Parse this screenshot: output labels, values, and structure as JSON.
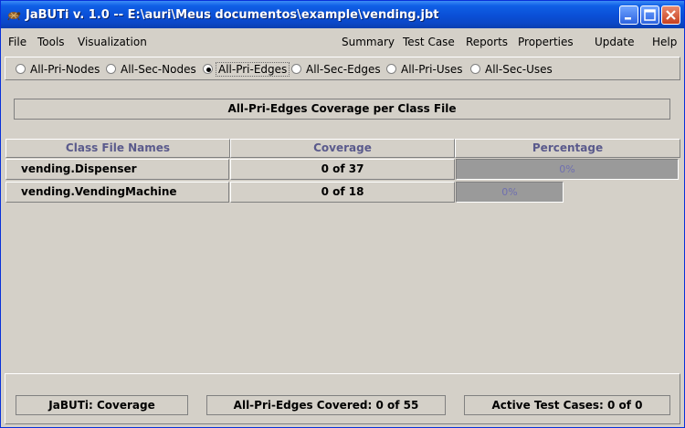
{
  "window": {
    "title": "JaBUTi v. 1.0 -- E:\\auri\\Meus documentos\\example\\vending.jbt"
  },
  "menu": {
    "left": [
      "File",
      "Tools",
      "Visualization"
    ],
    "right": [
      "Summary",
      "Test Case",
      "Reports",
      "Properties",
      "Update",
      "Help"
    ]
  },
  "criteria": {
    "options": [
      "All-Pri-Nodes",
      "All-Sec-Nodes",
      "All-Pri-Edges",
      "All-Sec-Edges",
      "All-Pri-Uses",
      "All-Sec-Uses"
    ],
    "selected": "All-Pri-Edges"
  },
  "panel": {
    "title": "All-Pri-Edges Coverage per Class File"
  },
  "table": {
    "headers": [
      "Class File Names",
      "Coverage",
      "Percentage"
    ],
    "rows": [
      {
        "name": "vending.Dispenser",
        "coverage": "0 of 37",
        "percent_label": "0%",
        "percent": 0
      },
      {
        "name": "vending.VendingMachine",
        "coverage": "0 of 18",
        "percent_label": "0%",
        "percent": 0
      }
    ]
  },
  "status": {
    "app": "JaBUTi: Coverage",
    "covered": "All-Pri-Edges Covered: 0 of 55",
    "active": "Active Test Cases: 0 of 0"
  },
  "colors": {
    "titlebar": "#0a4fd6",
    "header_text": "#5a5a8c",
    "bar_fill": "#9a9a9a"
  }
}
